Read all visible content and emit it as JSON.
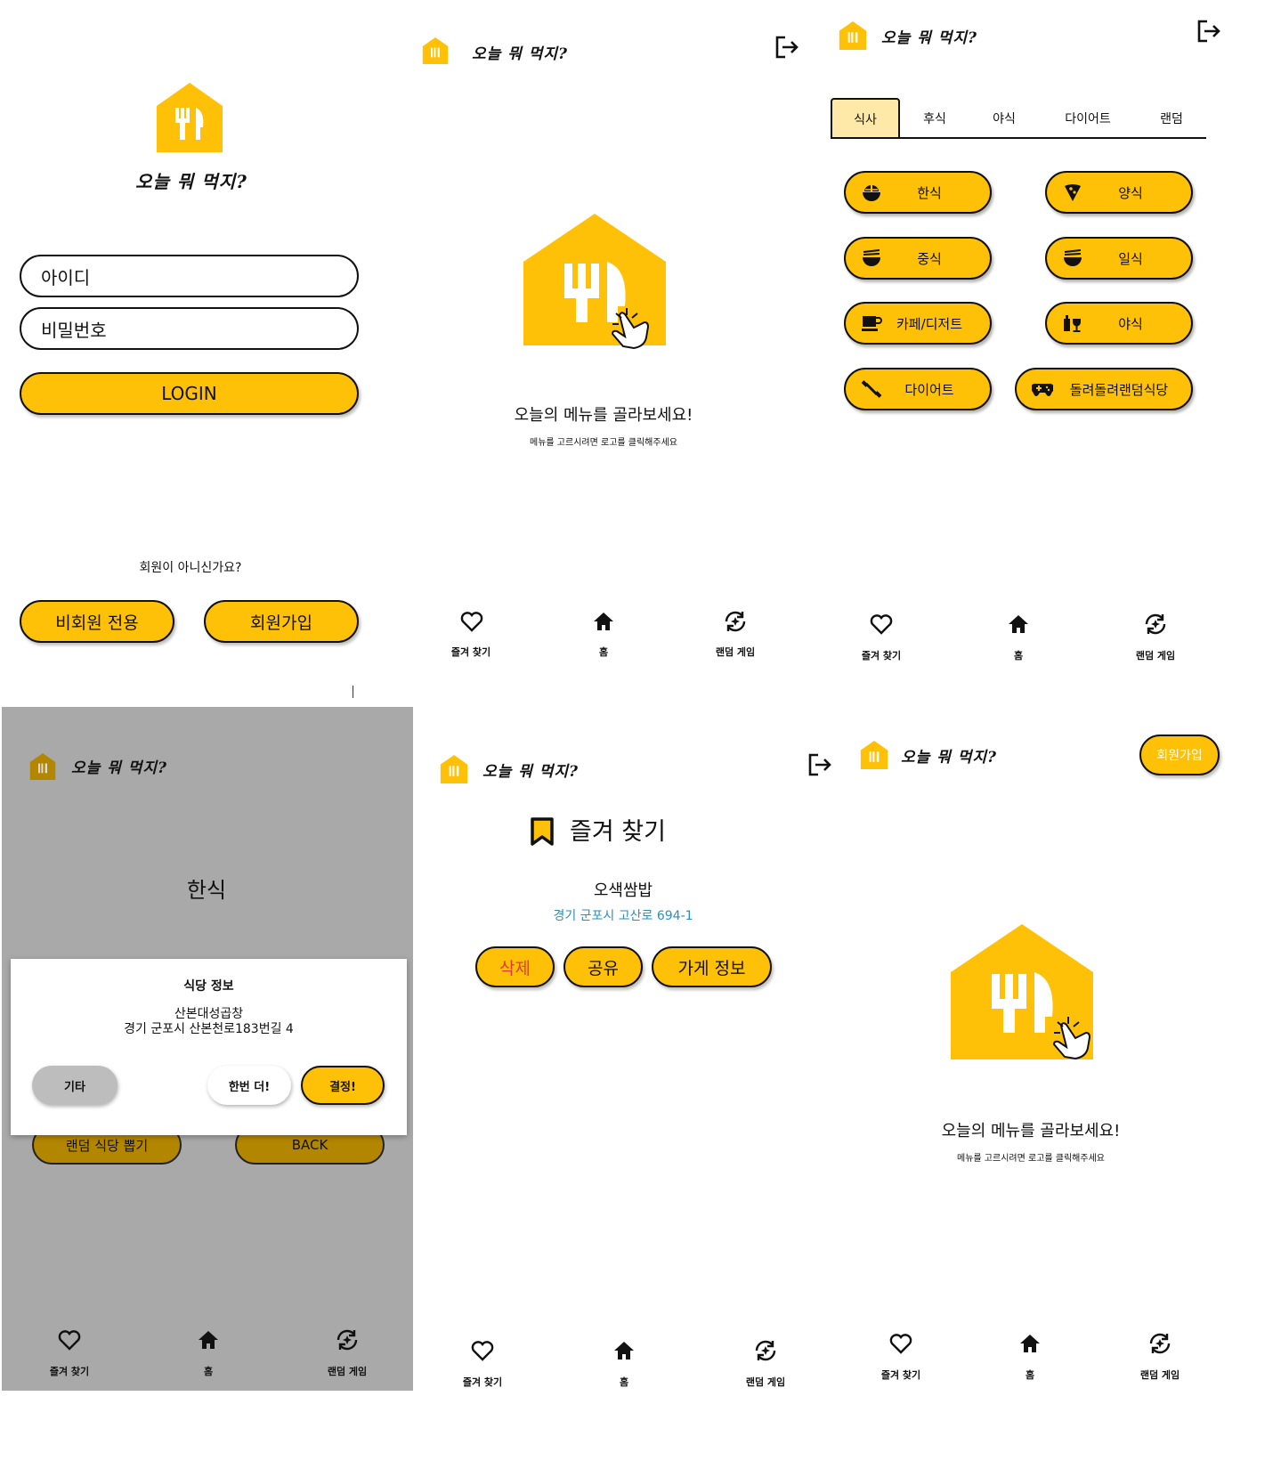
{
  "app": {
    "title": "오늘 뭐 먹지?",
    "accent": "#ffc107",
    "dim_bg": "#a9a9a9",
    "dim_accent": "#b38600"
  },
  "login": {
    "id_placeholder": "아이디",
    "pw_placeholder": "비밀번호",
    "login_label": "LOGIN",
    "not_member": "회원이 아니신가요?",
    "guest_label": "비회원 전용",
    "signup_label": "회원가입"
  },
  "home": {
    "headline": "오늘의 메뉴를 골라보세요!",
    "sub": "메뉴를 고르시려면 로고를 클릭해주세요"
  },
  "nav": {
    "favorites": "즐겨 찾기",
    "home": "홈",
    "random_game": "랜덤 게임"
  },
  "categories": {
    "tabs": [
      "식사",
      "후식",
      "야식",
      "다이어트",
      "랜덤"
    ],
    "items": [
      {
        "label": "한식",
        "icon": "rice-bowl-icon"
      },
      {
        "label": "양식",
        "icon": "pizza-icon"
      },
      {
        "label": "중식",
        "icon": "noodle-bowl-icon"
      },
      {
        "label": "일식",
        "icon": "noodle-bowl-icon"
      },
      {
        "label": "카페/디저트",
        "icon": "coffee-icon"
      },
      {
        "label": "야식",
        "icon": "drinks-icon"
      },
      {
        "label": "다이어트",
        "icon": "fitness-icon"
      },
      {
        "label": "돌려돌려랜덤식당",
        "icon": "gamepad-icon"
      }
    ]
  },
  "random_dialog": {
    "category": "한식",
    "title": "식당 정보",
    "restaurant": "산본대성곱창",
    "address": "경기 군포시 산본천로183번길 4",
    "other_label": "기타",
    "again_label": "한번 더!",
    "decide_label": "결정!",
    "random_pick_label": "랜덤 식당 뽑기",
    "back_label": "BACK"
  },
  "favorites": {
    "title": "즐겨 찾기",
    "name": "오색쌈밥",
    "address": "경기 군포시 고산로 694-1",
    "delete_label": "삭제",
    "share_label": "공유",
    "info_label": "가게 정보",
    "delete_color": "#e53935",
    "address_color": "#2a8fbd"
  },
  "guest_home": {
    "signup_label": "회원가입"
  }
}
